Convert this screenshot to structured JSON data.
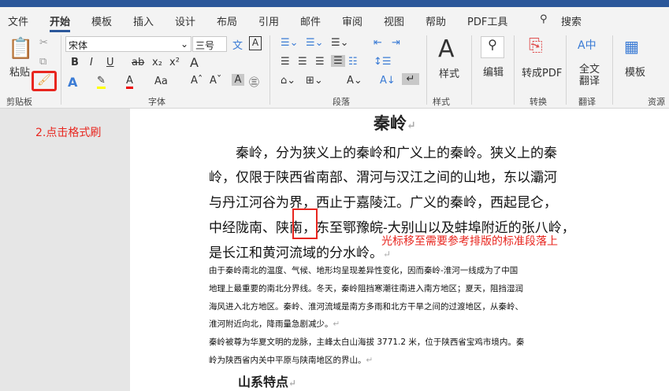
{
  "tabs": [
    "文件",
    "开始",
    "模板",
    "插入",
    "设计",
    "布局",
    "引用",
    "邮件",
    "审阅",
    "视图",
    "帮助",
    "PDF工具"
  ],
  "search": "搜索",
  "ribbon": {
    "paste": "粘贴",
    "clipboard": "剪贴板",
    "font_name": "宋体",
    "font_size": "三号",
    "font_group": "字体",
    "para_group": "段落",
    "styles": "样式",
    "styles_group": "样式",
    "edit": "编辑",
    "to_pdf": "转成PDF",
    "convert_group": "转换",
    "translate_line1": "全文",
    "translate_line2": "翻译",
    "translate_group": "翻译",
    "template": "模板",
    "resources_group": "资源",
    "wen": "文"
  },
  "annotations": {
    "step2": "2.点击格式刷",
    "cursor_hint": "光标移至需要参考排版的标准段落上"
  },
  "doc": {
    "title": "秦岭",
    "big_lines": [
      "秦岭，分为狭义上的秦岭和广义上的秦岭。狭义上的秦",
      "岭，仅限于陕西省南部、渭河与汉江之间的山地，东以灞河",
      "与丹江河谷为界，西止于嘉陵江。广义的秦岭，西起昆仑，",
      "中经陇南、陕南，东至鄂豫皖-大别山以及蚌埠附近的张八岭，",
      "是长江和黄河流域的分水岭。"
    ],
    "small_lines": [
      "由于秦岭南北的温度、气候、地形均呈现差异性变化，因而秦岭-淮河一线成为了中国",
      "地理上最重要的南北分界线。冬天，秦岭阻挡寒潮往南进入南方地区；夏天，阻挡湿润",
      "海风进入北方地区。秦岭、淮河流域是南方多雨和北方干旱之间的过渡地区，从秦岭、",
      "淮河附近向北，降雨量急剧减少。",
      "秦岭被尊为华夏文明的龙脉，主峰太白山海拔 3771.2 米，位于陕西省宝鸡市境内。秦",
      "岭为陕西省内关中平原与陕南地区的界山。"
    ],
    "heading2": "山系特点"
  }
}
